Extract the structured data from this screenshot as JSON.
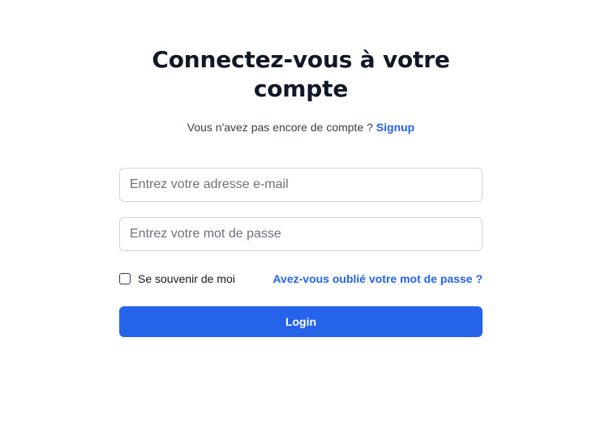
{
  "page": {
    "title": "Connectez-vous à votre compte",
    "subtitle_text": "Vous n'avez pas encore de compte ?",
    "signup_link": "Signup"
  },
  "form": {
    "email_placeholder": "Entrez votre adresse e-mail",
    "email_value": "",
    "password_placeholder": "Entrez votre mot de passe",
    "password_value": "",
    "remember_label": "Se souvenir de moi",
    "remember_checked": false,
    "forgot_link": "Avez-vous oublié votre mot de passe ?",
    "login_label": "Login"
  },
  "colors": {
    "accent": "#2563eb",
    "title": "#111827",
    "border": "#d1d5db"
  }
}
